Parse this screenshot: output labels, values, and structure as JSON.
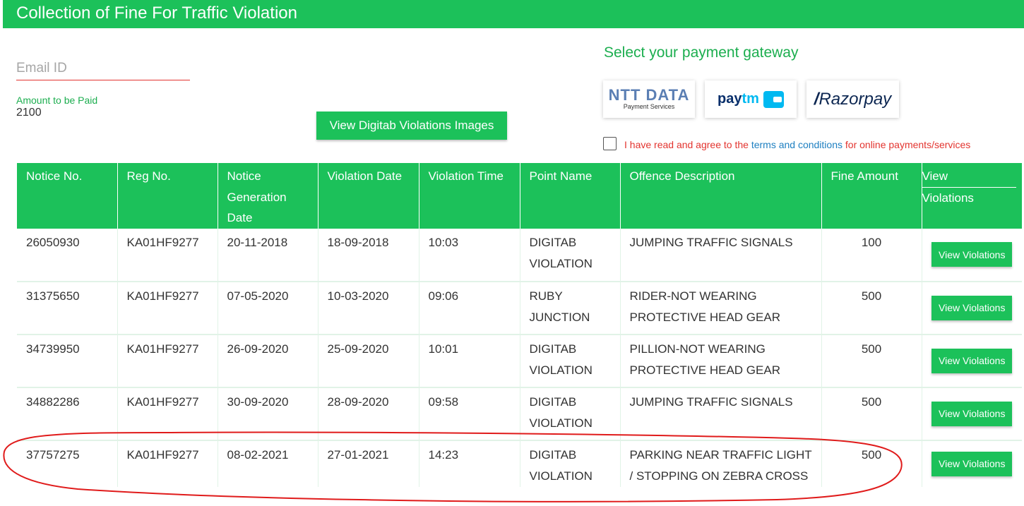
{
  "header": {
    "title": "Collection of Fine For Traffic Violation"
  },
  "form": {
    "email_placeholder": "Email ID",
    "amount_label": "Amount to be Paid",
    "amount_value": "2100",
    "view_images_label": "View Digitab Violations Images"
  },
  "gateway": {
    "title": "Select your payment gateway",
    "options": [
      {
        "name": "NTT DATA",
        "subtitle": "Payment Services"
      },
      {
        "name_part1": "pay",
        "name_part2": "tm",
        "icon": "wallet-icon"
      },
      {
        "name_mark": "/",
        "name": "Razorpay"
      }
    ],
    "terms_prefix": "I have read and agree to the ",
    "terms_link": "terms and conditions",
    "terms_suffix": " for online payments/services",
    "terms_checked": false
  },
  "table": {
    "headers": [
      "Notice No.",
      "Reg No.",
      "Notice Generation Date",
      "Violation Date",
      "Violation Time",
      "Point Name",
      "Offence Description",
      "Fine Amount",
      "View",
      "Violations"
    ],
    "button_label": "View Violations",
    "rows": [
      {
        "notice": "26050930",
        "reg": "KA01HF9277",
        "notice_date": "20-11-2018",
        "violation_date": "18-09-2018",
        "time": "10:03",
        "point": "DIGITAB VIOLATION",
        "offence": "JUMPING TRAFFIC SIGNALS",
        "fine": "100"
      },
      {
        "notice": "31375650",
        "reg": "KA01HF9277",
        "notice_date": "07-05-2020",
        "violation_date": "10-03-2020",
        "time": "09:06",
        "point": "RUBY JUNCTION",
        "offence": "RIDER-NOT WEARING PROTECTIVE HEAD GEAR",
        "fine": "500"
      },
      {
        "notice": "34739950",
        "reg": "KA01HF9277",
        "notice_date": "26-09-2020",
        "violation_date": "25-09-2020",
        "time": "10:01",
        "point": "DIGITAB VIOLATION",
        "offence": "PILLION-NOT WEARING PROTECTIVE HEAD GEAR",
        "fine": "500"
      },
      {
        "notice": "34882286",
        "reg": "KA01HF9277",
        "notice_date": "30-09-2020",
        "violation_date": "28-09-2020",
        "time": "09:58",
        "point": "DIGITAB VIOLATION",
        "offence": "JUMPING TRAFFIC SIGNALS",
        "fine": "500"
      },
      {
        "notice": "37757275",
        "reg": "KA01HF9277",
        "notice_date": "08-02-2021",
        "violation_date": "27-01-2021",
        "time": "14:23",
        "point": "DIGITAB VIOLATION",
        "offence": "PARKING NEAR TRAFFIC LIGHT / STOPPING ON ZEBRA CROSS",
        "fine": "500"
      }
    ]
  },
  "colors": {
    "accent": "#1cc15a",
    "label_green": "#1cae4f",
    "error_red": "#e3342f",
    "link_blue": "#1d7fc1"
  }
}
